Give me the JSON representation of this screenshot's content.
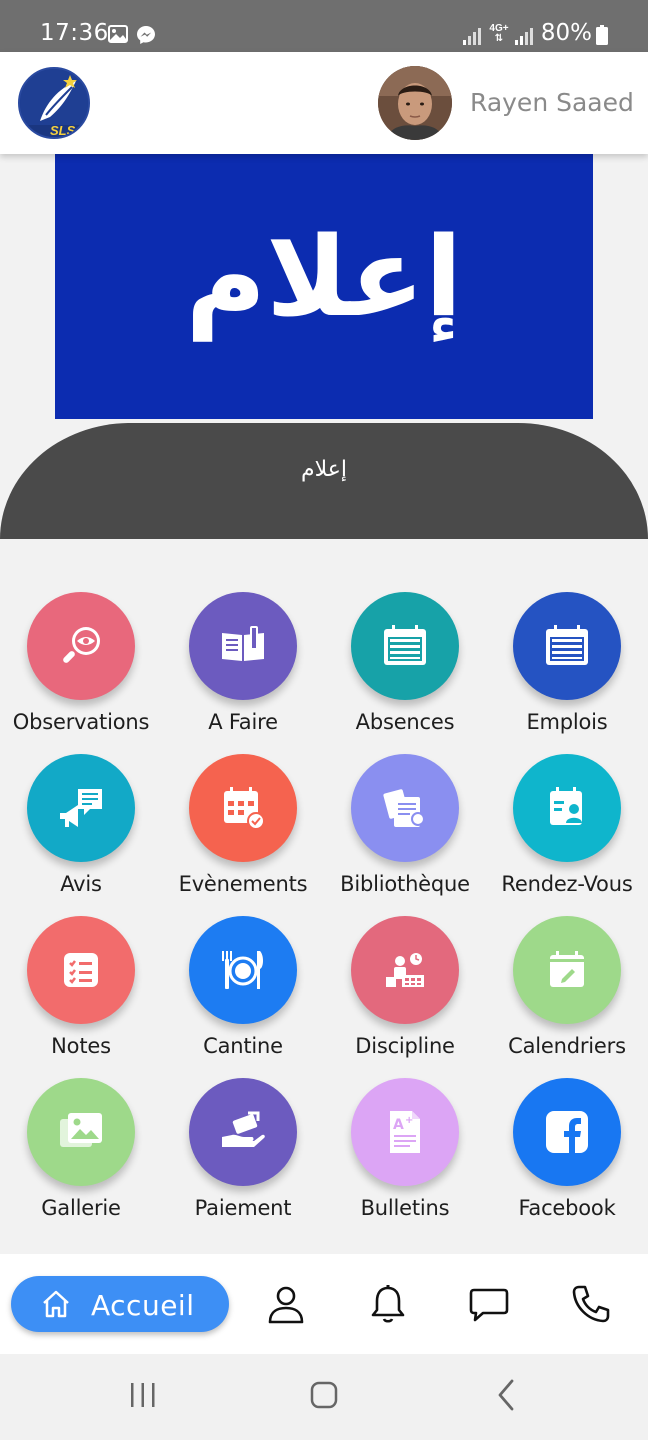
{
  "status_bar": {
    "time": "17:36",
    "network": "4G+",
    "battery": "80%"
  },
  "header": {
    "logo_text": "SLS",
    "user_name": "Rayen Saaed"
  },
  "banner": {
    "title": "إعلام",
    "caption": "إعلام",
    "color": "#0c2cb0"
  },
  "menu": {
    "items": [
      {
        "label": "Observations",
        "icon": "magnifier-eye-icon",
        "color": "#e8687c"
      },
      {
        "label": "A Faire",
        "icon": "book-pen-icon",
        "color": "#6c5bbf"
      },
      {
        "label": "Absences",
        "icon": "calendar-grid-icon",
        "color": "#17a2a8"
      },
      {
        "label": "Emplois",
        "icon": "calendar-grid-icon",
        "color": "#2553c2"
      },
      {
        "label": "Avis",
        "icon": "megaphone-chat-icon",
        "color": "#12a9c7"
      },
      {
        "label": "Evènements",
        "icon": "calendar-check-icon",
        "color": "#f5634f"
      },
      {
        "label": "Bibliothèque",
        "icon": "documents-icon",
        "color": "#8a8ff0"
      },
      {
        "label": "Rendez-Vous",
        "icon": "appointment-person-icon",
        "color": "#0fb5cc"
      },
      {
        "label": "Notes",
        "icon": "checklist-icon",
        "color": "#f26c6c"
      },
      {
        "label": "Cantine",
        "icon": "plate-cutlery-icon",
        "color": "#1d7cf2"
      },
      {
        "label": "Discipline",
        "icon": "classroom-clock-icon",
        "color": "#e3697d"
      },
      {
        "label": "Calendriers",
        "icon": "calendar-pencil-icon",
        "color": "#9ed98a"
      },
      {
        "label": "Gallerie",
        "icon": "photo-gallery-icon",
        "color": "#9ed98a"
      },
      {
        "label": "Paiement",
        "icon": "hand-payment-icon",
        "color": "#6c5bbf"
      },
      {
        "label": "Bulletins",
        "icon": "report-card-icon",
        "color": "#dca5f5"
      },
      {
        "label": "Facebook",
        "icon": "facebook-icon",
        "color": "#1877f2"
      }
    ]
  },
  "bottom_nav": {
    "home_label": "Accueil",
    "accent": "#3d8ff5",
    "items": [
      "profile-icon",
      "bell-icon",
      "chat-icon",
      "phone-icon"
    ]
  }
}
